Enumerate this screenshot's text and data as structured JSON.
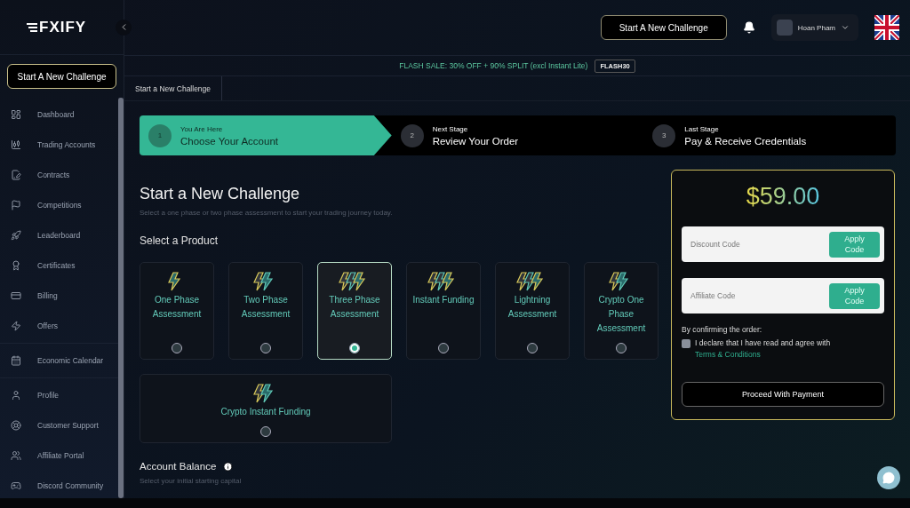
{
  "sidebar": {
    "logo": "FXIFY",
    "cta": "Start A New Challenge",
    "groups": [
      [
        {
          "label": "Dashboard"
        },
        {
          "label": "Trading Accounts"
        },
        {
          "label": "Contracts"
        },
        {
          "label": "Competitions"
        },
        {
          "label": "Leaderboard"
        },
        {
          "label": "Certificates"
        },
        {
          "label": "Billing"
        },
        {
          "label": "Offers"
        }
      ],
      [
        {
          "label": "Economic Calendar"
        }
      ],
      [
        {
          "label": "Profile"
        },
        {
          "label": "Customer Support"
        },
        {
          "label": "Affiliate Portal"
        },
        {
          "label": "Discord Community"
        }
      ]
    ]
  },
  "header": {
    "cta": "Start A New Challenge",
    "user": "Hoan Pham"
  },
  "promo": {
    "text": "FLASH SALE: 30% OFF + 90% SPLIT (excl Instant Lite)",
    "code": "FLASH30"
  },
  "breadcrumb": "Start a New Challenge",
  "steps": [
    {
      "number": "1",
      "caption": "You Are Here",
      "title": "Choose Your Account",
      "selected": true
    },
    {
      "number": "2",
      "caption": "Next Stage",
      "title": "Review Your Order",
      "selected": false
    },
    {
      "number": "3",
      "caption": "Last Stage",
      "title": "Pay & Receive Credentials",
      "selected": false
    }
  ],
  "title": "Start a New Challenge",
  "subtitle": "Select a one phase or two phase assessment to start your trading journey today.",
  "product_heading": "Select a Product",
  "products": [
    {
      "label": "One Phase Assessment",
      "selected": false
    },
    {
      "label": "Two Phase Assessment",
      "selected": false
    },
    {
      "label": "Three Phase Assessment",
      "selected": true
    },
    {
      "label": "Instant Funding",
      "selected": false
    },
    {
      "label": "Lightning Assessment",
      "selected": false
    },
    {
      "label": "Crypto One Phase Assessment",
      "selected": false
    },
    {
      "label": "Crypto Instant Funding",
      "selected": false
    }
  ],
  "balance": {
    "title": "Account Balance",
    "subtitle": "Select your initial starting capital"
  },
  "order": {
    "price": "$59.00",
    "discount": {
      "placeholder": "Discount Code",
      "button": "Apply Code"
    },
    "affiliate": {
      "placeholder": "Affiliate Code",
      "button": "Apply Code"
    },
    "confirm": "By confirming the order:",
    "agree": "I declare that I have read and agree with",
    "link": "Terms & Conditions",
    "checked": false,
    "submit": "Proceed With Payment"
  }
}
